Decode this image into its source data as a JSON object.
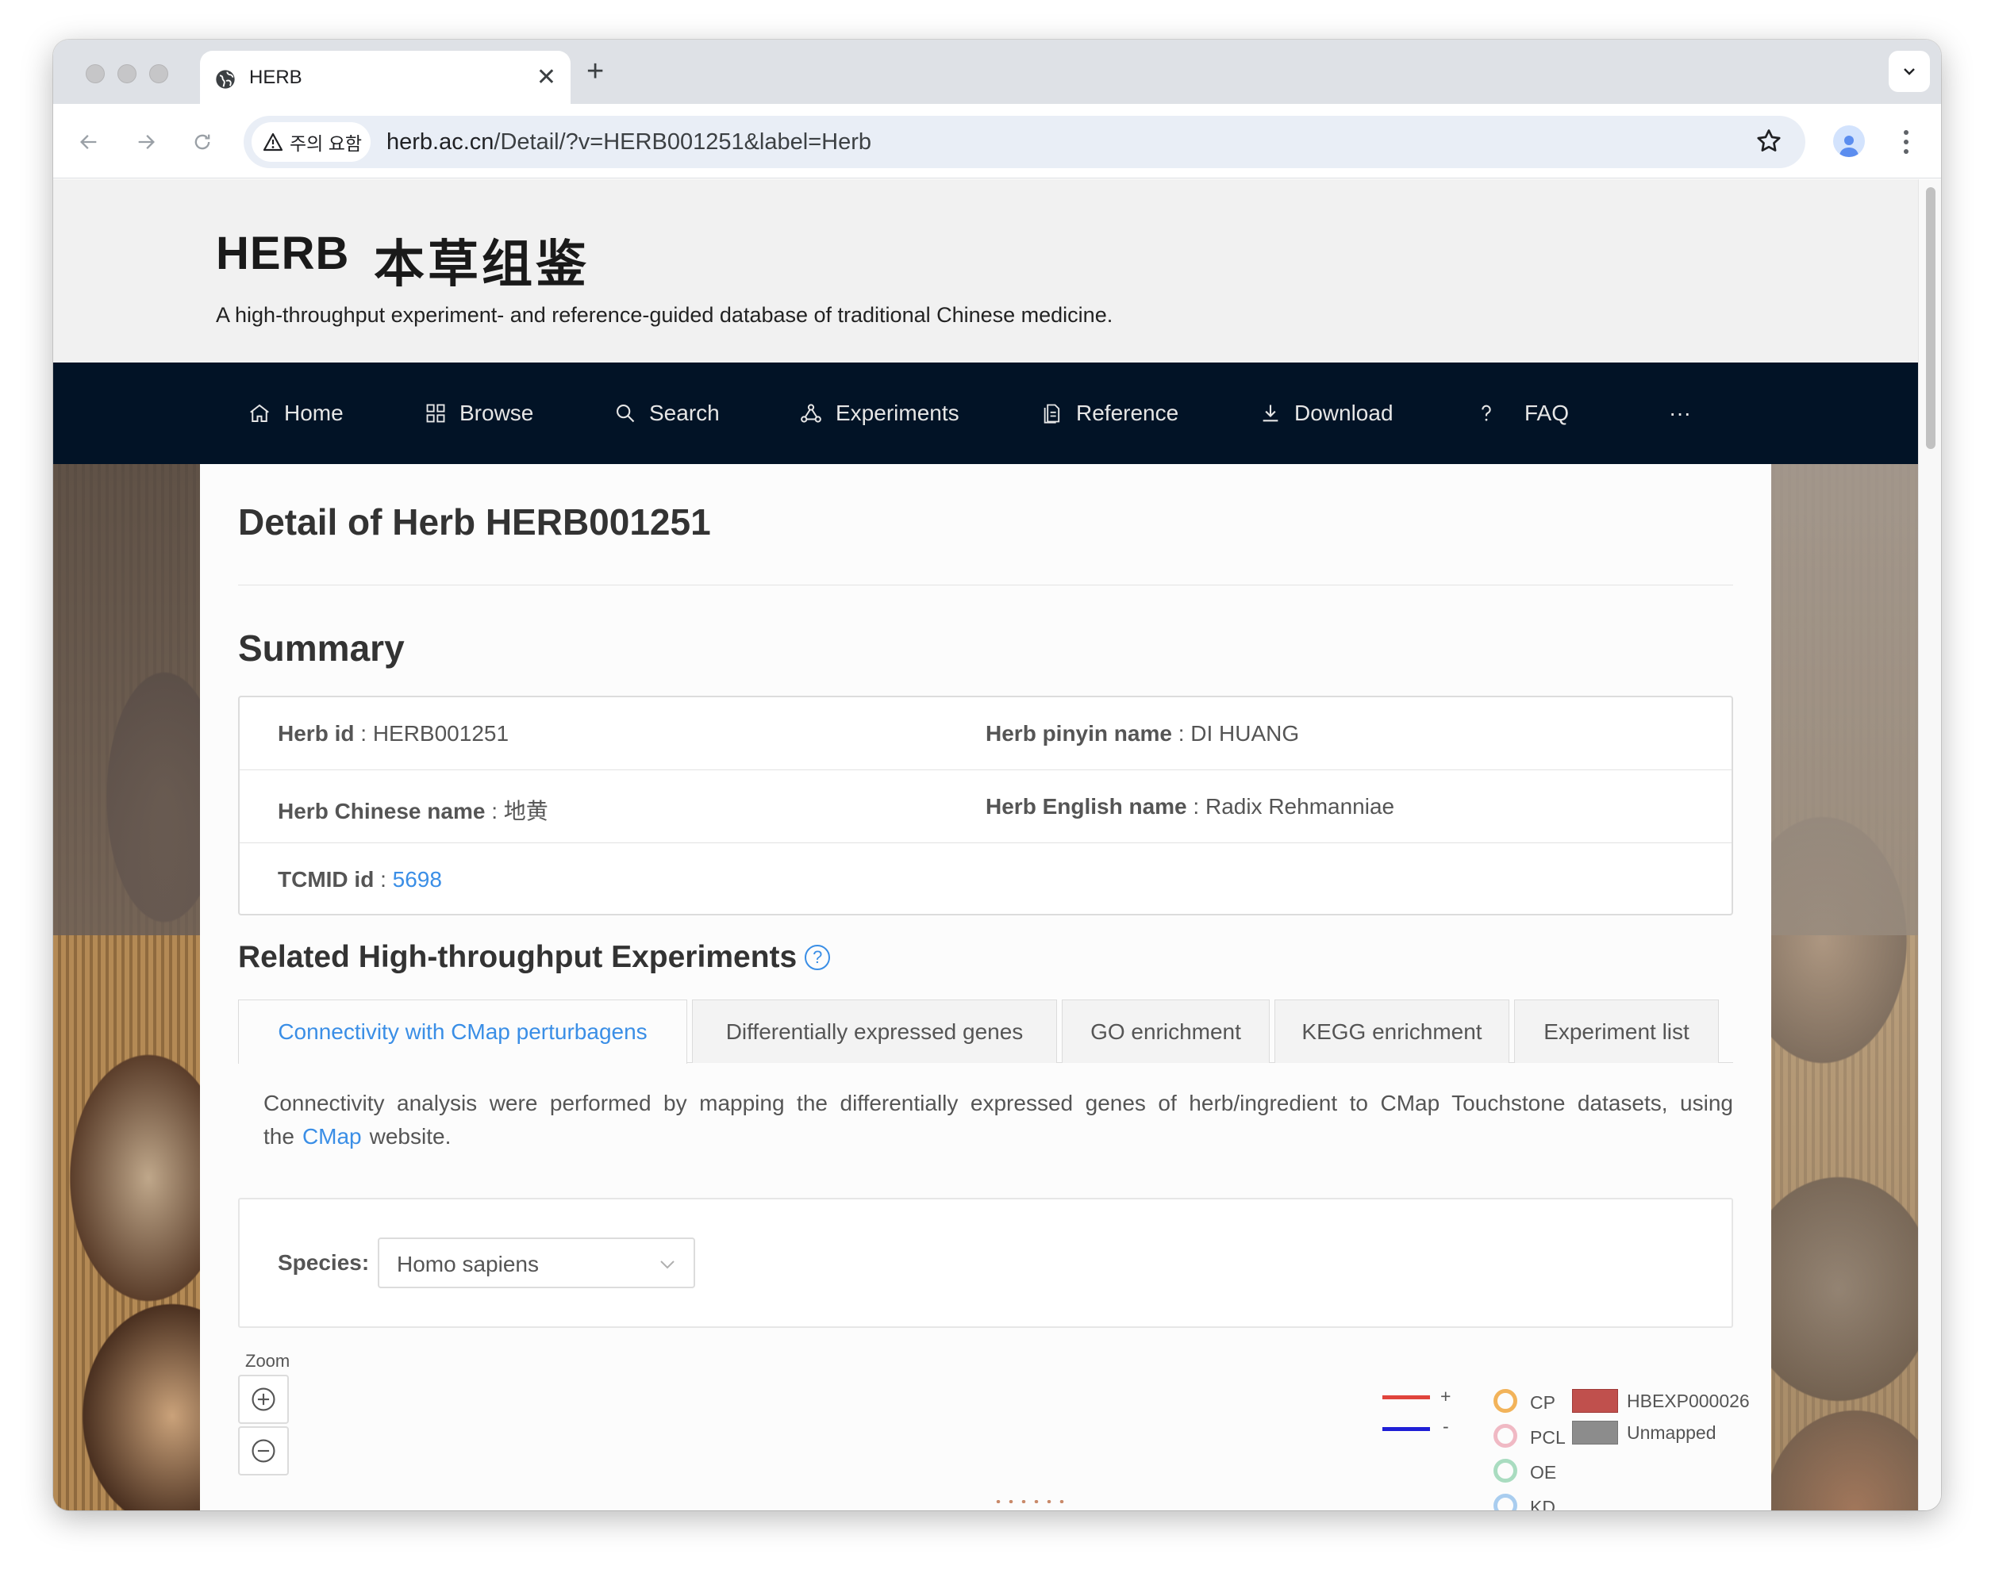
{
  "browser": {
    "tab_title": "HERB",
    "security_label": "주의 요함",
    "url_host": "herb.ac.cn",
    "url_path": "/Detail/?v=HERB001251&label=Herb"
  },
  "site": {
    "logo_en": "HERB",
    "logo_cn": "本草组鉴",
    "tagline": "A high-throughput experiment- and reference-guided database of traditional Chinese medicine."
  },
  "nav": {
    "items": [
      {
        "label": "Home",
        "icon": "home-icon"
      },
      {
        "label": "Browse",
        "icon": "grid-icon"
      },
      {
        "label": "Search",
        "icon": "search-icon"
      },
      {
        "label": "Experiments",
        "icon": "network-icon"
      },
      {
        "label": "Reference",
        "icon": "document-icon"
      },
      {
        "label": "Download",
        "icon": "download-icon"
      },
      {
        "label": "FAQ",
        "icon": "question-icon"
      }
    ],
    "more": "···"
  },
  "page": {
    "title": "Detail of Herb HERB001251",
    "summary_heading": "Summary",
    "summary": {
      "herb_id_label": "Herb id",
      "herb_id": "HERB001251",
      "pinyin_label": "Herb pinyin name",
      "pinyin": "DI HUANG",
      "chinese_label": "Herb Chinese name",
      "chinese": "地黄",
      "english_label": "Herb English name",
      "english": "Radix Rehmanniae",
      "tcmid_label": "TCMID id",
      "tcmid": "5698",
      "separator": ":"
    },
    "related_heading": "Related High-throughput Experiments",
    "help_glyph": "?",
    "tabs": [
      "Connectivity with CMap perturbagens",
      "Differentially expressed genes",
      "GO enrichment",
      "KEGG enrichment",
      "Experiment list"
    ],
    "desc_pre": "Connectivity analysis were performed by mapping the differentially expressed genes of herb/ingredient to CMap Touchstone datasets, using the",
    "desc_link": "CMap",
    "desc_post": "website.",
    "species_label": "Species:",
    "species_value": "Homo sapiens",
    "zoom_label": "Zoom"
  },
  "legend": {
    "plus": "+",
    "minus": "-",
    "plus_color": "#e0443c",
    "minus_color": "#1f1fd6",
    "rings": [
      {
        "label": "CP",
        "color": "#f2b35a"
      },
      {
        "label": "PCL",
        "color": "#f0b9c4"
      },
      {
        "label": "OE",
        "color": "#a9dcc0"
      },
      {
        "label": "KD",
        "color": "#a9cdef"
      }
    ],
    "swatches": [
      {
        "label": "HBEXP000026",
        "color": "#c0504d"
      },
      {
        "label": "Unmapped",
        "color": "#8c8c8c"
      }
    ]
  }
}
